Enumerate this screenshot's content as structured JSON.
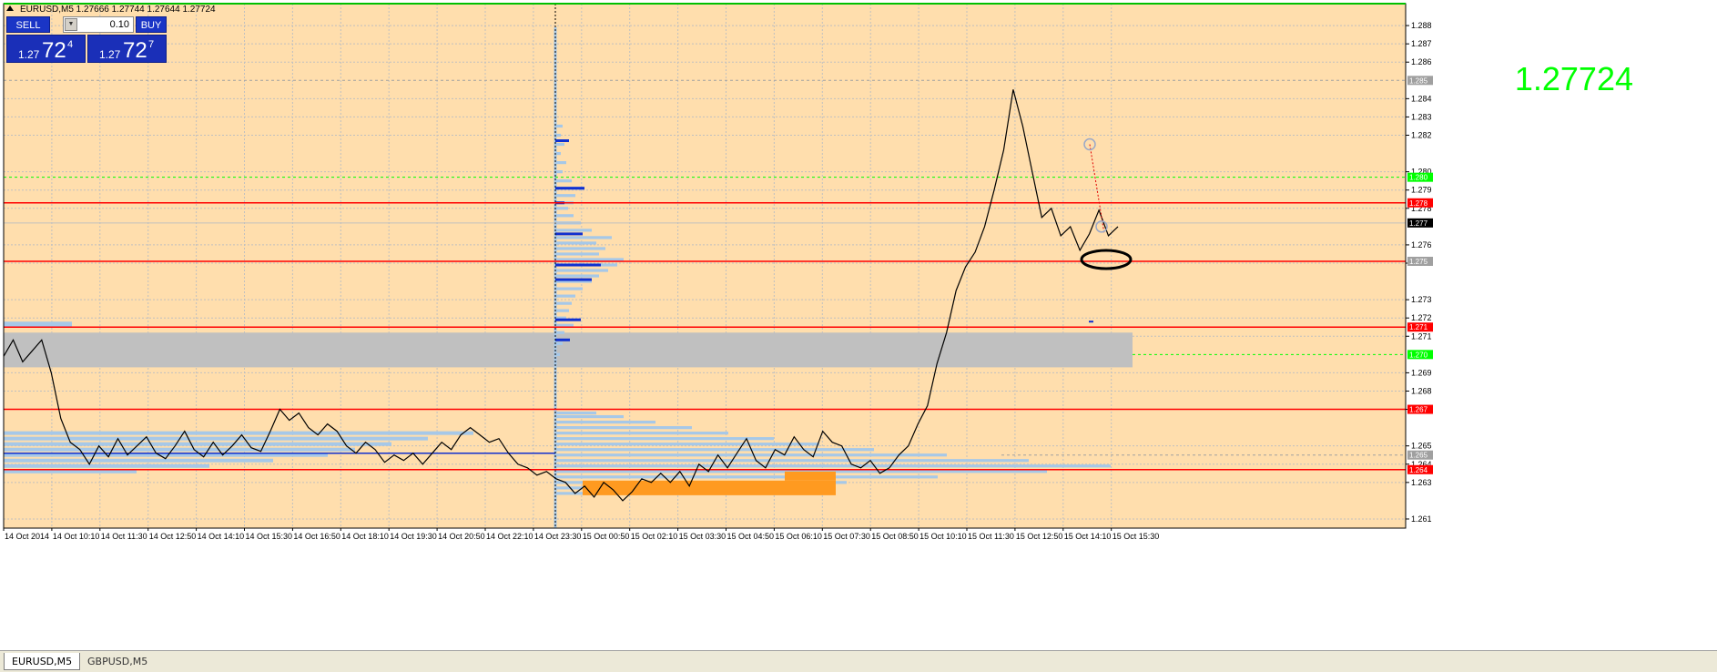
{
  "chart": {
    "symbol_header": "EURUSD,M5  1.27666 1.27744 1.27644 1.27724",
    "current_price_big": "1.27724",
    "colors": {
      "background": "#ffdead",
      "grid": "#c0c0c0",
      "price_line": "#000000",
      "red_levels": "#ff0000",
      "green_levels": "#00ff00",
      "profile": "#a6c8e8",
      "profile_dark": "#1030d0",
      "orange_block": "#ff9a20",
      "gray_zone": "#c0c0c0"
    }
  },
  "trade_panel": {
    "sell_label": "SELL",
    "buy_label": "BUY",
    "lot_value": "0.10",
    "sell_price_small": "1.27",
    "sell_price_big": "72",
    "sell_price_sup": "4",
    "buy_price_small": "1.27",
    "buy_price_big": "72",
    "buy_price_sup": "7"
  },
  "chart_data": {
    "type": "line",
    "title": "",
    "x_labels": [
      "14 Oct 2014",
      "14 Oct 10:10",
      "14 Oct 11:30",
      "14 Oct 12:50",
      "14 Oct 14:10",
      "14 Oct 15:30",
      "14 Oct 16:50",
      "14 Oct 18:10",
      "14 Oct 19:30",
      "14 Oct 20:50",
      "14 Oct 22:10",
      "14 Oct 23:30",
      "15 Oct 00:50",
      "15 Oct 02:10",
      "15 Oct 03:30",
      "15 Oct 04:50",
      "15 Oct 06:10",
      "15 Oct 07:30",
      "15 Oct 08:50",
      "15 Oct 10:10",
      "15 Oct 11:30",
      "15 Oct 12:50",
      "15 Oct 14:10",
      "15 Oct 15:30"
    ],
    "y_ticks": [
      "1.288",
      "1.287",
      "1.286",
      "1.284",
      "1.283",
      "1.282",
      "1.280",
      "1.279",
      "1.278",
      "1.276",
      "1.275",
      "1.273",
      "1.272",
      "1.271",
      "1.269",
      "1.268",
      "1.267",
      "1.265",
      "1.264",
      "1.263",
      "1.261"
    ],
    "ylim": [
      1.2605,
      1.2892
    ],
    "series": [
      {
        "values": [
          1.2699,
          1.2708,
          1.2696,
          1.2702,
          1.2708,
          1.269,
          1.2665,
          1.2652,
          1.2648,
          1.264,
          1.265,
          1.2644,
          1.2654,
          1.2645,
          1.265,
          1.2655,
          1.2646,
          1.2643,
          1.265,
          1.2658,
          1.2648,
          1.2644,
          1.2652,
          1.2645,
          1.265,
          1.2656,
          1.2649,
          1.2647,
          1.2658,
          1.267,
          1.2664,
          1.2668,
          1.266,
          1.2656,
          1.2662,
          1.2658,
          1.265,
          1.2646,
          1.2652,
          1.2648,
          1.2641,
          1.2645,
          1.2642,
          1.2646,
          1.264,
          1.2646,
          1.2652,
          1.2648,
          1.2656,
          1.266,
          1.2656,
          1.2652,
          1.2654,
          1.2646,
          1.264,
          1.2638,
          1.2634,
          1.2636,
          1.2632,
          1.263,
          1.2624,
          1.2628,
          1.2622,
          1.263,
          1.2626,
          1.262,
          1.2625,
          1.2632,
          1.263,
          1.2635,
          1.263,
          1.2636,
          1.2628,
          1.264,
          1.2636,
          1.2645,
          1.2638,
          1.2646,
          1.2654,
          1.2642,
          1.2638,
          1.2648,
          1.2645,
          1.2655,
          1.2648,
          1.2644,
          1.2658,
          1.2652,
          1.265,
          1.264,
          1.2638,
          1.2642,
          1.2635,
          1.2638,
          1.2645,
          1.265,
          1.2662,
          1.2672,
          1.2695,
          1.2712,
          1.2735,
          1.2748,
          1.2756,
          1.277,
          1.279,
          1.2812,
          1.2845,
          1.2825,
          1.28,
          1.2775,
          1.278,
          1.2765,
          1.277,
          1.2757,
          1.2766,
          1.2779,
          1.2765,
          1.277
        ]
      }
    ],
    "levels_red": [
      1.2783,
      1.2751,
      1.2715,
      1.267,
      1.2637
    ],
    "levels_green_dashed": [
      1.2797,
      1.27
    ],
    "level_gray": 1.285,
    "current_level": 1.2772,
    "gray_zone": [
      1.2693,
      1.2712
    ],
    "right_tags": [
      {
        "label": "1.285",
        "value": 1.285,
        "color": "#a0a0a0"
      },
      {
        "label": "1.280",
        "value": 1.2797,
        "color": "#00ff00"
      },
      {
        "label": "1.278",
        "value": 1.2783,
        "color": "#ff0000"
      },
      {
        "label": "1.277",
        "value": 1.2772,
        "color": "#000000"
      },
      {
        "label": "1.275",
        "value": 1.2751,
        "color": "#a0a0a0"
      },
      {
        "label": "1.271",
        "value": 1.2715,
        "color": "#ff0000"
      },
      {
        "label": "1.270",
        "value": 1.27,
        "color": "#00ff00"
      },
      {
        "label": "1.267",
        "value": 1.267,
        "color": "#ff0000"
      },
      {
        "label": "1.265",
        "value": 1.2645,
        "color": "#a0a0a0"
      },
      {
        "label": "1.264",
        "value": 1.2637,
        "color": "#ff0000"
      }
    ]
  },
  "tabs": [
    {
      "label": "EURUSD,M5",
      "active": true
    },
    {
      "label": "GBPUSD,M5",
      "active": false
    }
  ]
}
